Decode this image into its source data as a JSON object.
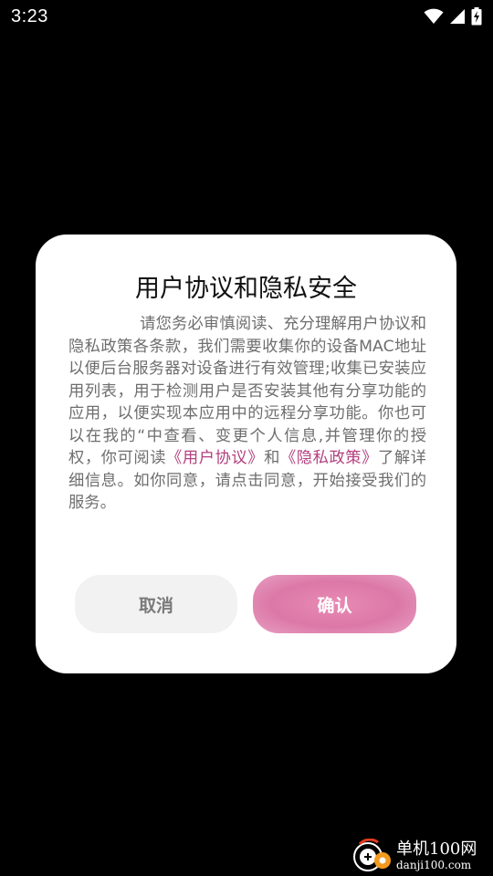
{
  "status_bar": {
    "time": "3:23",
    "icons": [
      "wifi-icon",
      "cell-signal-icon",
      "battery-charging-icon"
    ]
  },
  "dialog": {
    "title": "用户协议和隐私安全",
    "body_part1": "请您务必审慎阅读、充分理解用户协议和隐私政策各条款，我们需要收集你的设备MAC地址以便后台服务器对设备进行有效管理;收集已安装应用列表，用于检测用户是否安装其他有分享功能的应用，以便实现本应用中的远程分享功能。你也可以在我的“中查看、变更个人信息,并管理你的授权，你可阅读",
    "link_user_agreement": "《用户协议》",
    "connector": "和",
    "link_privacy_policy": "《隐私政策》",
    "body_part2": "了解详细信息。如你同意，请点击同意，开始接受我们的服务。",
    "cancel_label": "取消",
    "confirm_label": "确认"
  },
  "watermark": {
    "title": "单机100网",
    "url": "danji100.com"
  },
  "colors": {
    "background": "#000000",
    "dialog_bg": "#ffffff",
    "link": "#b3407f",
    "confirm_button": "#dc78a7",
    "cancel_button": "#f2f2f2"
  }
}
